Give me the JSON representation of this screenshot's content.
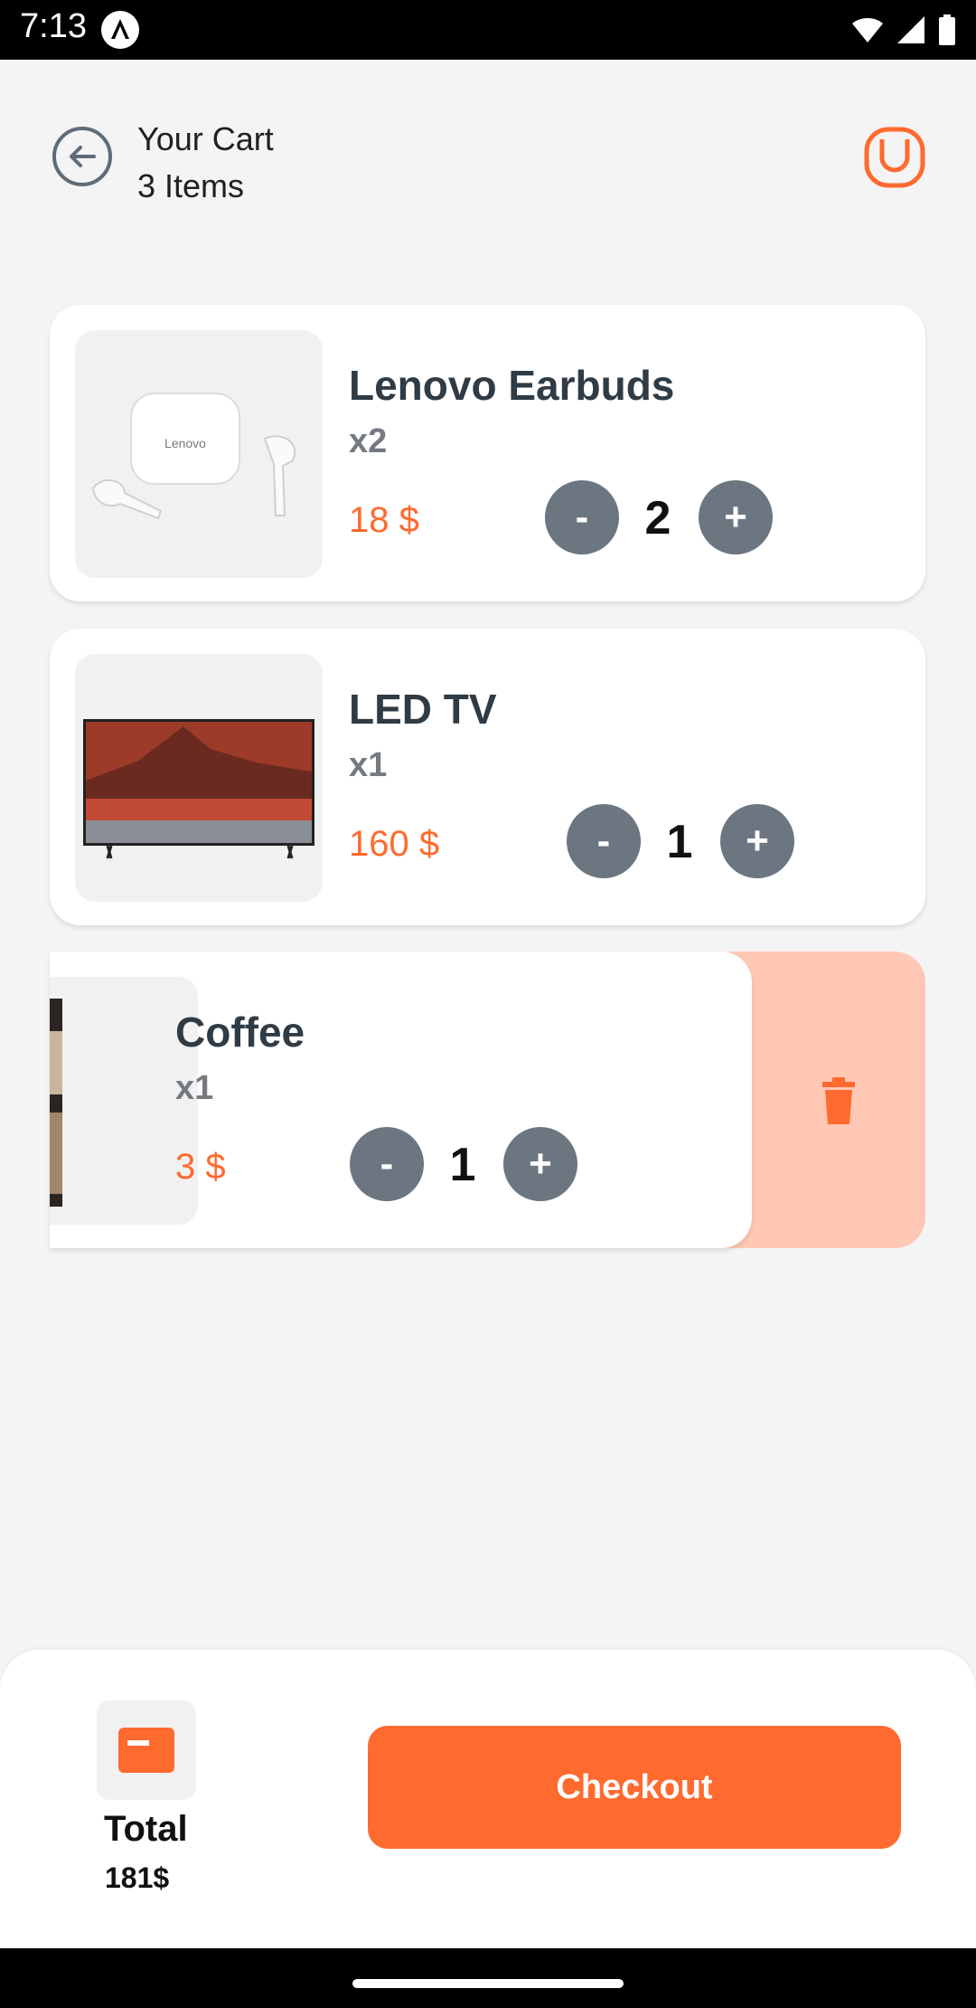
{
  "status_bar": {
    "time": "7:13"
  },
  "header": {
    "title": "Your Cart",
    "subtitle": "3 Items"
  },
  "items": [
    {
      "name": "Lenovo Earbuds",
      "qty_label": "x2",
      "price": "18 $",
      "quantity": "2",
      "minus": "-",
      "plus": "+"
    },
    {
      "name": "LED TV",
      "qty_label": "x1",
      "price": "160 $",
      "quantity": "1",
      "minus": "-",
      "plus": "+"
    },
    {
      "name": "Coffee",
      "qty_label": "x1",
      "price": "3 $",
      "quantity": "1",
      "minus": "-",
      "plus": "+"
    }
  ],
  "footer": {
    "total_label": "Total",
    "total_value": "181$",
    "checkout_label": "Checkout"
  },
  "colors": {
    "accent": "#ff6a2f",
    "delete_bg": "#ffc8b4",
    "stepper": "#6b7681"
  }
}
